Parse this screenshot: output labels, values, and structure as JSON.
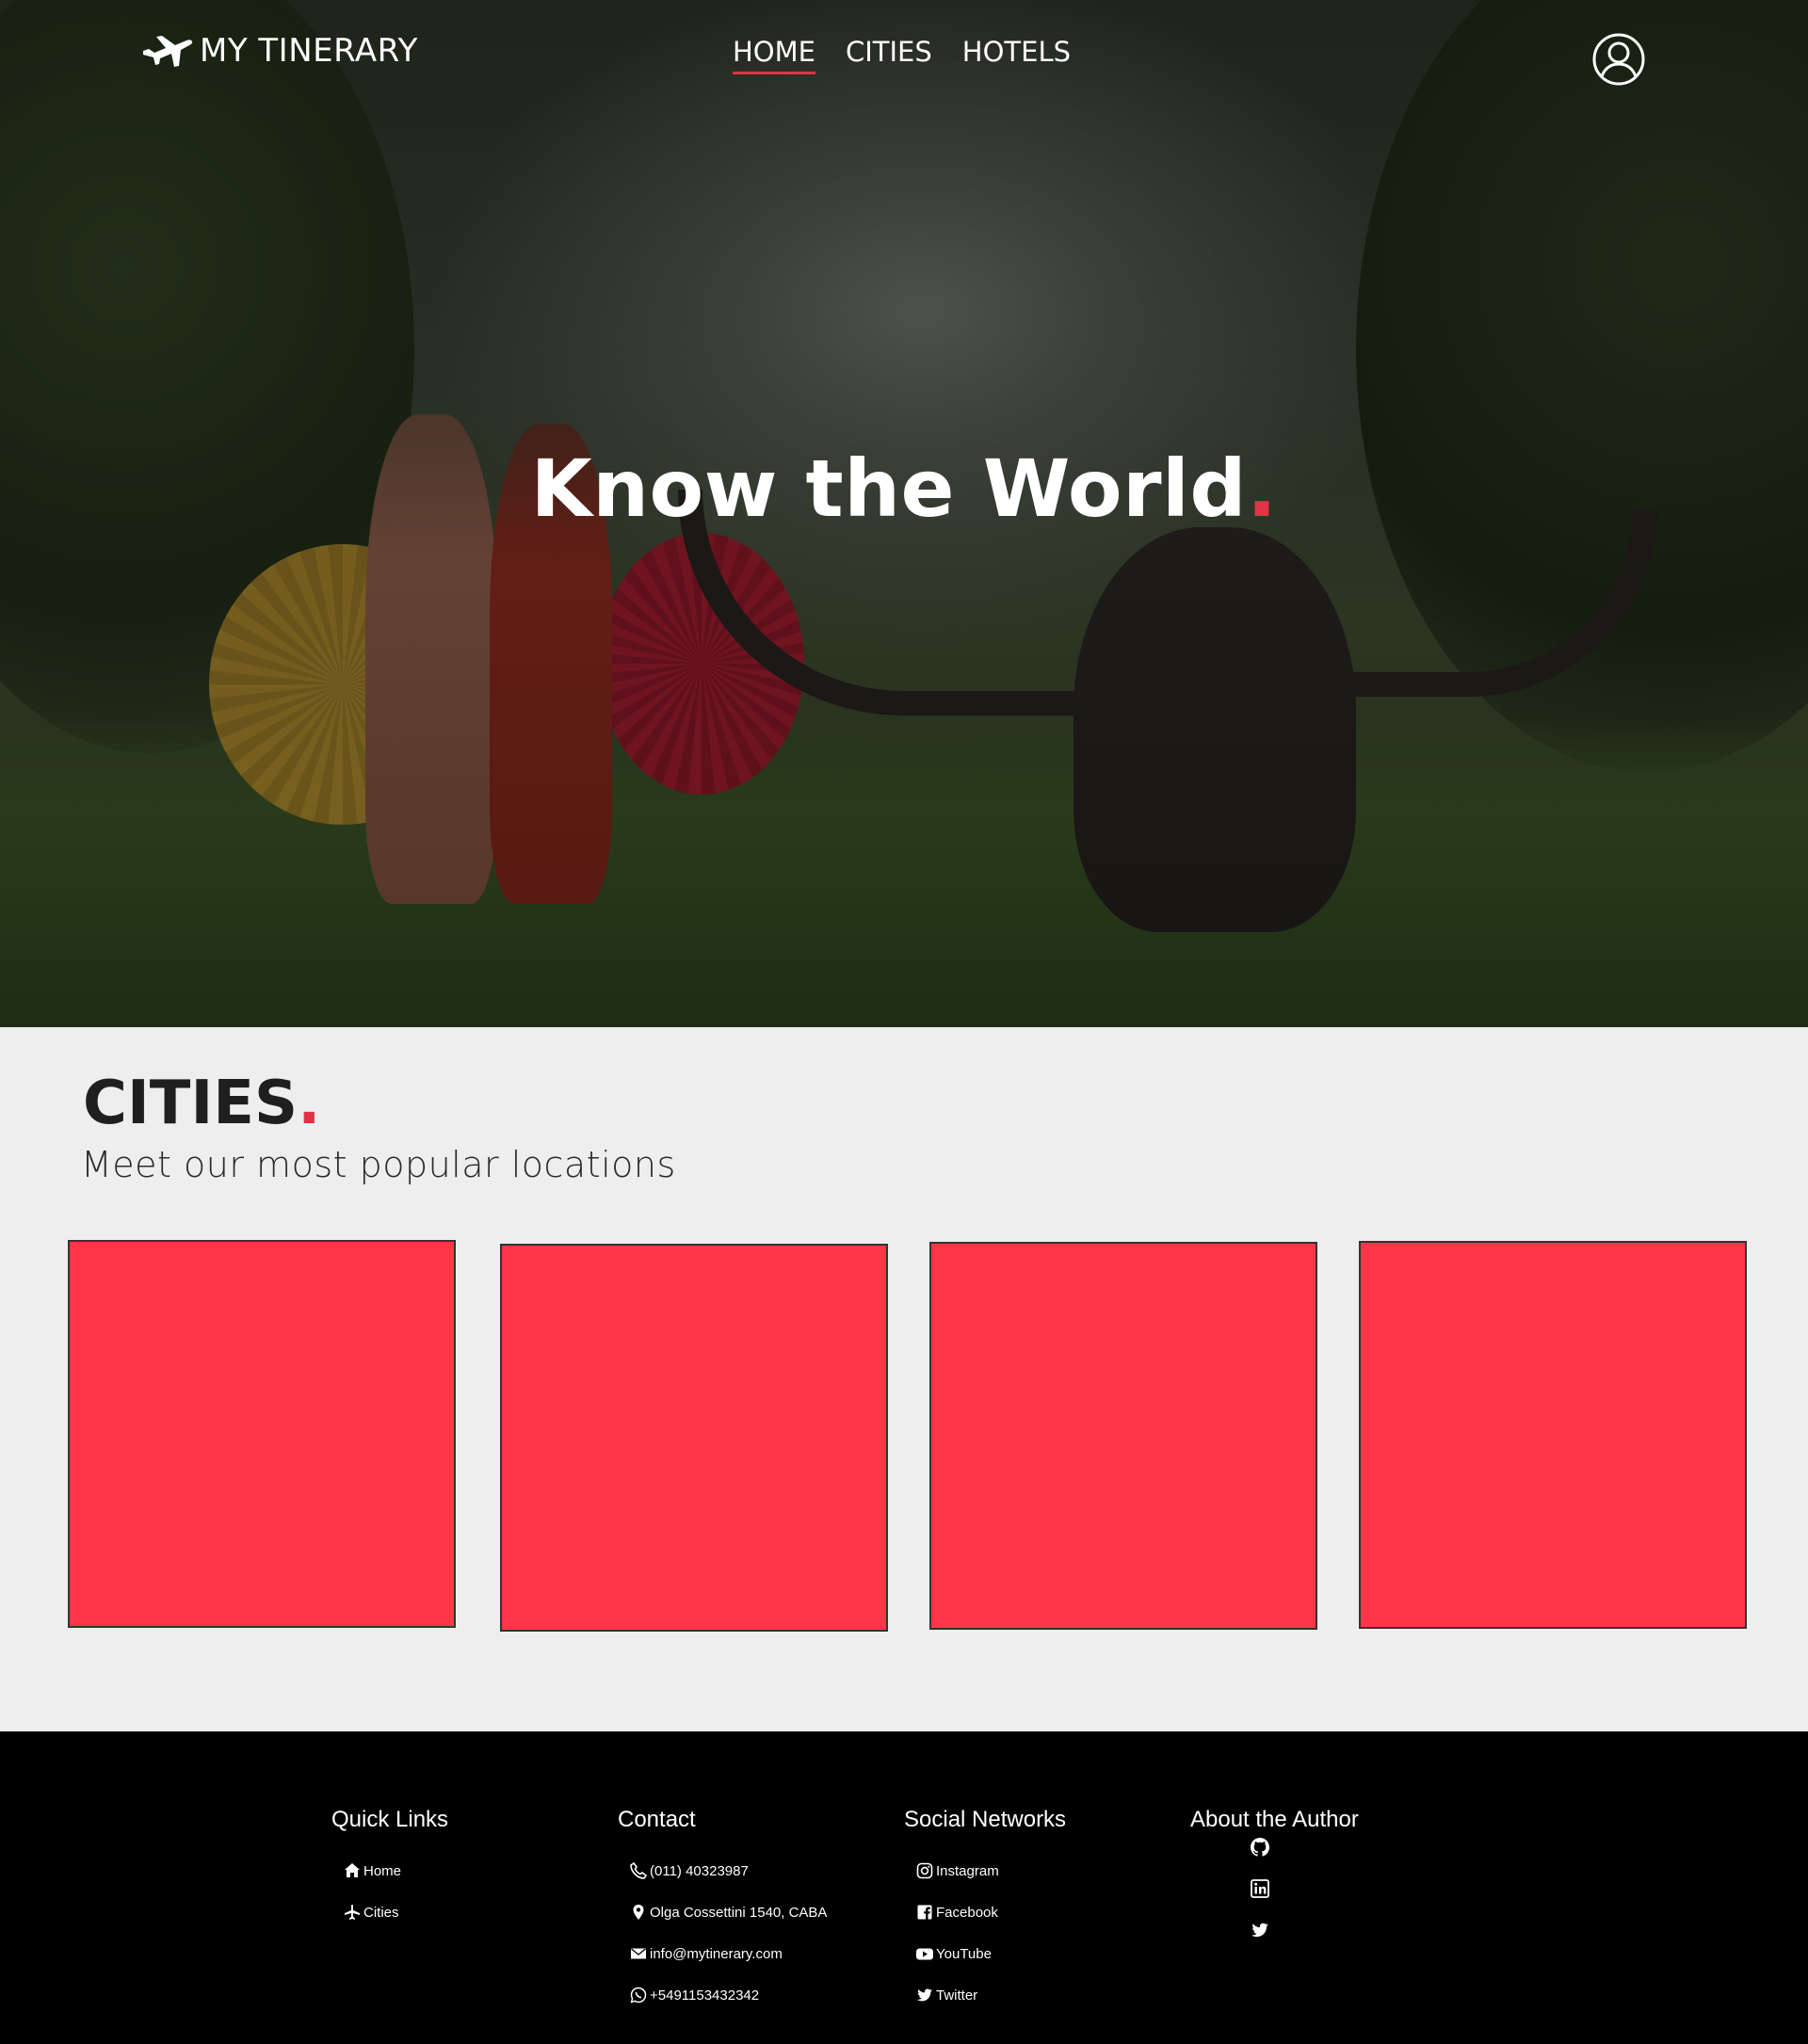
{
  "nav": {
    "brand": "MY TINERARY",
    "links": [
      {
        "label": "HOME",
        "active": true
      },
      {
        "label": "CITIES",
        "active": false
      },
      {
        "label": "HOTELS",
        "active": false
      }
    ]
  },
  "hero": {
    "title": "Know the World",
    "title_dot": "."
  },
  "cities": {
    "title": "CITIES",
    "title_dot": ".",
    "subtitle": "Meet our most popular locations",
    "card_color": "#ff3647"
  },
  "footer": {
    "quick_links": {
      "heading": "Quick Links",
      "items": [
        {
          "label": "Home",
          "icon": "home-icon"
        },
        {
          "label": "Cities",
          "icon": "plane-icon"
        }
      ]
    },
    "contact": {
      "heading": "Contact",
      "items": [
        {
          "label": "(011) 40323987",
          "icon": "phone-icon"
        },
        {
          "label": "Olga Cossettini 1540, CABA",
          "icon": "location-pin-icon"
        },
        {
          "label": "info@mytinerary.com",
          "icon": "envelope-icon"
        },
        {
          "label": "+5491153432342",
          "icon": "whatsapp-icon"
        }
      ]
    },
    "social": {
      "heading": "Social Networks",
      "items": [
        {
          "label": "Instagram",
          "icon": "instagram-icon"
        },
        {
          "label": "Facebook",
          "icon": "facebook-icon"
        },
        {
          "label": "YouTube",
          "icon": "youtube-icon"
        },
        {
          "label": "Twitter",
          "icon": "twitter-icon"
        }
      ]
    },
    "author": {
      "heading": "About the Author",
      "icons": [
        "github-icon",
        "linkedin-icon",
        "twitter-icon"
      ]
    }
  },
  "colors": {
    "accent": "#e03347",
    "footer_bg": "#000000",
    "section_bg": "#eeeeee"
  }
}
